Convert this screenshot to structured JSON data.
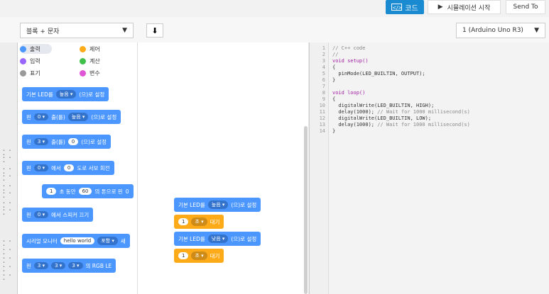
{
  "topbar": {
    "code_label": "코드",
    "code_icon": "code-icon",
    "sim_label": "시뮬레이션 시작",
    "sim_icon": "play-icon",
    "send_label": "Send To"
  },
  "toolbar": {
    "block_mode": "블록 + 문자",
    "download_icon": "download-icon",
    "board": "1 (Arduino Uno R3)"
  },
  "categories": [
    {
      "label": "출력",
      "color": "#4c97ff"
    },
    {
      "label": "제어",
      "color": "#ffab19"
    },
    {
      "label": "입력",
      "color": "#9966ff"
    },
    {
      "label": "계산",
      "color": "#40bf4a"
    },
    {
      "label": "표기",
      "color": "#999999"
    },
    {
      "label": "변수",
      "color": "#e054d6"
    }
  ],
  "palette_blocks": {
    "b1": {
      "a": "기본 LED를",
      "b": "높음 ▾",
      "c": "(으)로 설정"
    },
    "b2": {
      "a": "핀",
      "b": "0 ▾",
      "c": "출(를)",
      "d": "높음 ▾",
      "e": "(으)로 설정"
    },
    "b3": {
      "a": "핀",
      "b": "3 ▾",
      "c": "출(를)",
      "d": "0",
      "e": "(으)로 설정"
    },
    "b4": {
      "a": "핀",
      "b": "0 ▾",
      "c": "에서",
      "d": "0",
      "e": "도로 서보 회전"
    },
    "b5": {
      "a": "1",
      "b": "초 동안",
      "c": "60",
      "d": "의 톤으로 핀",
      "e": "0"
    },
    "b6": {
      "a": "핀",
      "b": "0 ▾",
      "c": "에서 스피커 끄기"
    },
    "b7": {
      "a": "시리얼 모니터",
      "b": "hello world",
      "c": "포함 ▾",
      "d": "새"
    },
    "b8": {
      "a": "핀",
      "b": "3 ▾",
      "c": "3 ▾",
      "d": "3 ▾",
      "e": "의 RGB LE"
    }
  },
  "workspace_blocks": {
    "w1": {
      "a": "기본 LED를",
      "b": "높음 ▾",
      "c": "(으)로 설정"
    },
    "w2": {
      "a": "1",
      "b": "초 ▾",
      "c": "대기"
    },
    "w3": {
      "a": "기본 LED를",
      "b": "낮음 ▾",
      "c": "(으)로 설정"
    },
    "w4": {
      "a": "1",
      "b": "초 ▾",
      "c": "대기"
    }
  },
  "code": {
    "line_numbers": [
      "1",
      "2",
      "3",
      "4",
      "5",
      "6",
      "7",
      "8",
      "9",
      "10",
      "11",
      "12",
      "13",
      "14"
    ],
    "l1": "// C++ code",
    "l2": "//",
    "l3": "void setup()",
    "l4": "{",
    "l5": "  pinMode(LED_BUILTIN, OUTPUT);",
    "l6": "}",
    "l7": "",
    "l8": "void loop()",
    "l9": "{",
    "l10": "  digitalWrite(LED_BUILTIN, HIGH);",
    "l11a": "  delay(1000); ",
    "l11b": "// Wait for 1000 millisecond(s)",
    "l12": "  digitalWrite(LED_BUILTIN, LOW);",
    "l13a": "  delay(1000); ",
    "l13b": "// Wait for 1000 millisecond(s)",
    "l14": "}"
  }
}
